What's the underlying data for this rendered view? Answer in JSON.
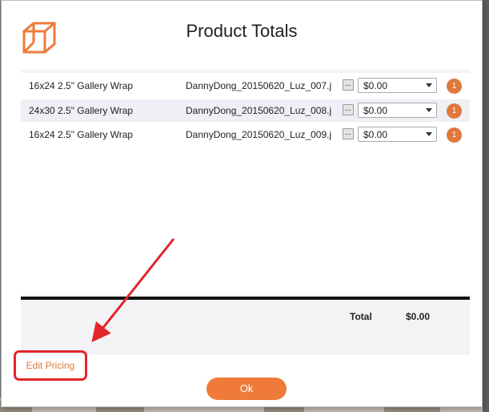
{
  "dialog": {
    "title": "Product Totals"
  },
  "rows": [
    {
      "description": "16x24 2.5\" Gallery Wrap",
      "file": "DannyDong_20150620_Luz_007.j",
      "more": "...",
      "price": "$0.00",
      "qty": "1"
    },
    {
      "description": "24x30 2.5\" Gallery Wrap",
      "file": "DannyDong_20150620_Luz_008.j",
      "more": "...",
      "price": "$0.00",
      "qty": "1"
    },
    {
      "description": "16x24 2.5\" Gallery Wrap",
      "file": "DannyDong_20150620_Luz_009.j",
      "more": "...",
      "price": "$0.00",
      "qty": "1"
    }
  ],
  "totals": {
    "label": "Total",
    "value": "$0.00"
  },
  "edit_pricing_label": "Edit Pricing",
  "ok_label": "Ok",
  "colors": {
    "accent": "#ef7a3a",
    "annotation": "#e3242b",
    "badge": "#e0783c"
  },
  "icons": {
    "logo": "cube-logo-icon",
    "dropdown": "chevron-down-icon"
  }
}
